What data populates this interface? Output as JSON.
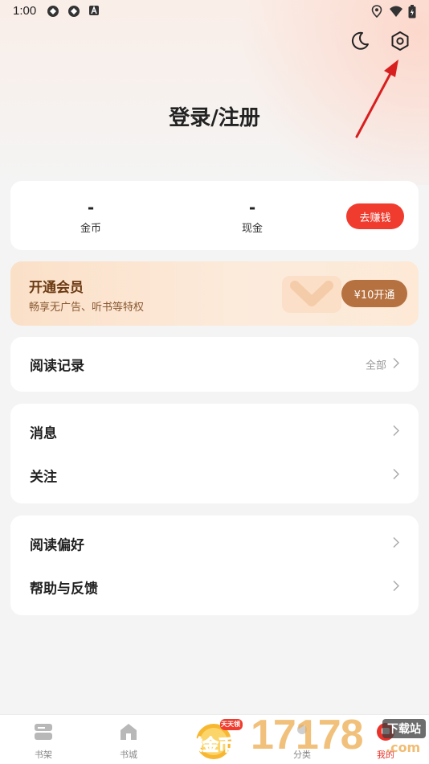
{
  "status_bar": {
    "time": "1:00"
  },
  "header": {
    "title": "登录/注册"
  },
  "stats": {
    "coins_value": "-",
    "coins_label": "金币",
    "cash_value": "-",
    "cash_label": "现金",
    "earn_button": "去赚钱"
  },
  "vip": {
    "title": "开通会员",
    "subtitle": "畅享无广告、听书等特权",
    "button": "¥10开通"
  },
  "reading_history": {
    "label": "阅读记录",
    "extra": "全部"
  },
  "menu_group_1": [
    {
      "label": "消息"
    },
    {
      "label": "关注"
    }
  ],
  "menu_group_2": [
    {
      "label": "阅读偏好"
    },
    {
      "label": "帮助与反馈"
    }
  ],
  "bottom_nav": {
    "bookshelf": "书架",
    "bookstore": "书城",
    "earn": "赚金币",
    "earn_tag": "天天领",
    "category": "分类",
    "mine": "我的"
  },
  "watermark": {
    "number": "17178",
    "tag": "下载站",
    "suffix": ".com"
  },
  "colors": {
    "accent_red": "#f03c2e",
    "vip_brown": "#b5713f",
    "arrow_red": "#d81f1f"
  }
}
